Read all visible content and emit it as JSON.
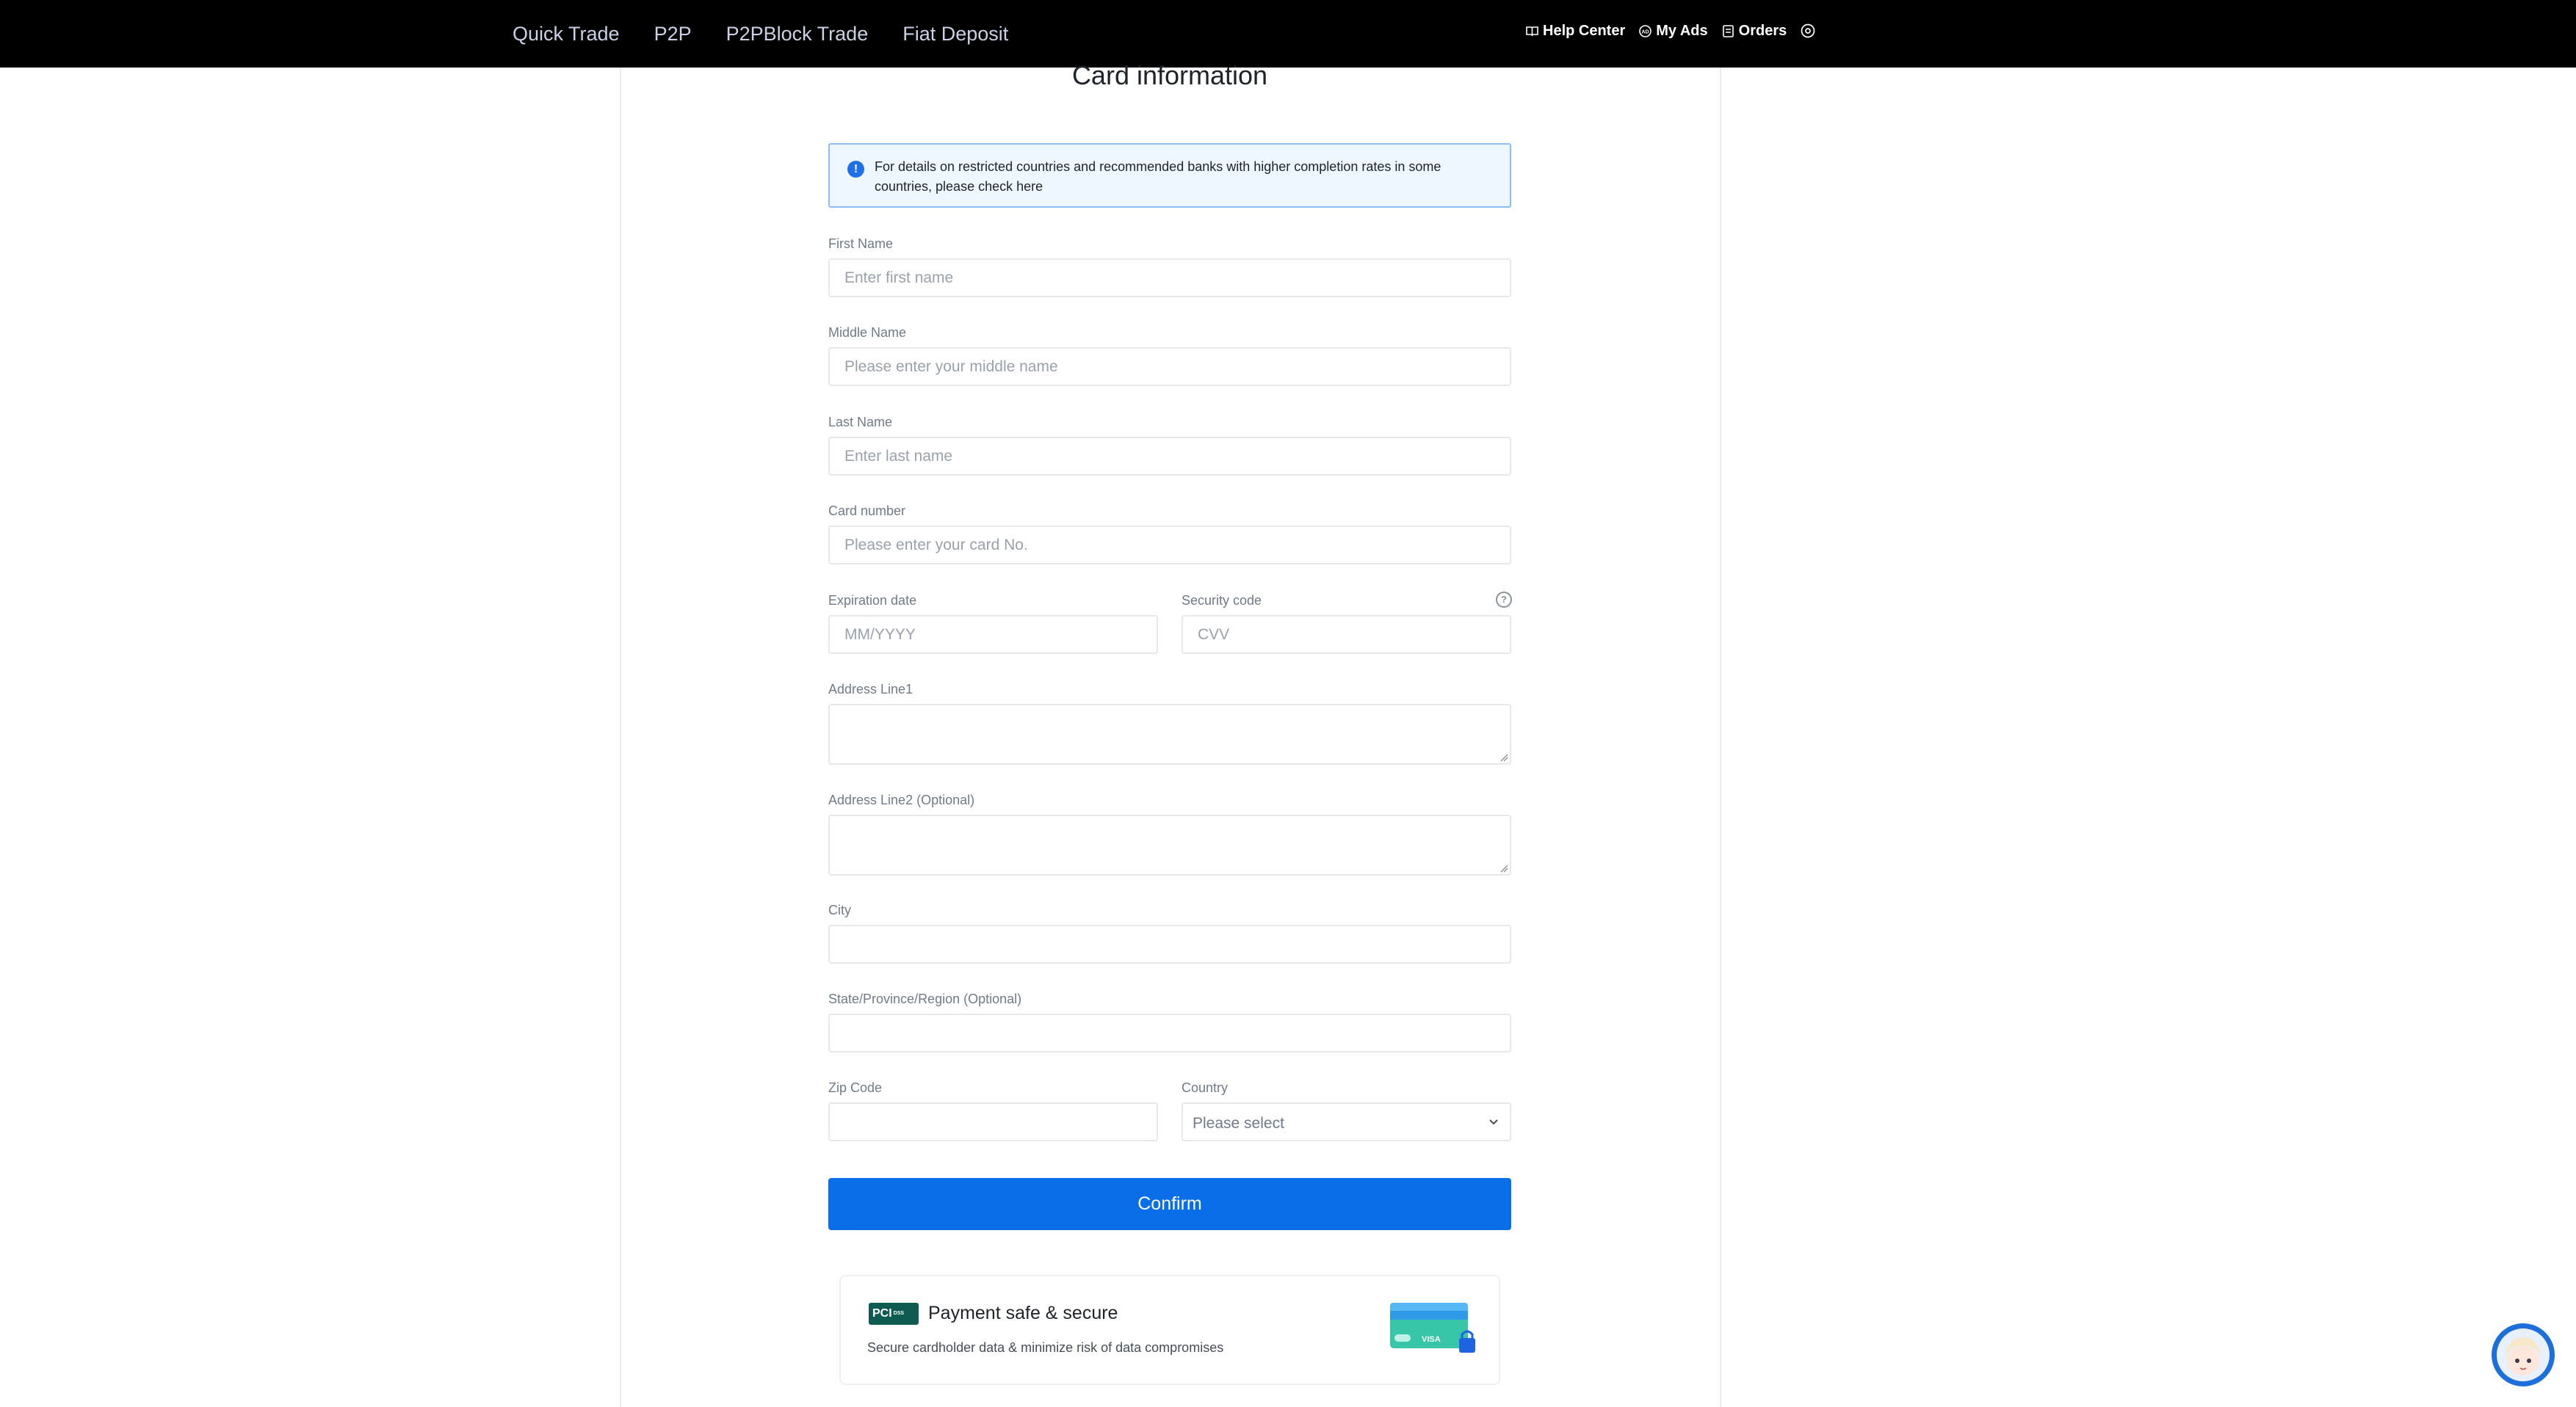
{
  "nav": {
    "items": [
      "Quick Trade",
      "P2P",
      "P2PBlock Trade",
      "Fiat Deposit"
    ],
    "help_center": "Help Center",
    "my_ads": "My Ads",
    "orders": "Orders"
  },
  "page": {
    "title": "Card information"
  },
  "notice": {
    "text": "For details on restricted countries and recommended banks with higher completion rates in some countries, please check here"
  },
  "form": {
    "first_name": {
      "label": "First Name",
      "placeholder": "Enter first name",
      "value": ""
    },
    "middle_name": {
      "label": "Middle Name",
      "placeholder": "Please enter your middle name",
      "value": ""
    },
    "last_name": {
      "label": "Last Name",
      "placeholder": "Enter last name",
      "value": ""
    },
    "card_number": {
      "label": "Card number",
      "placeholder": "Please enter your card No.",
      "value": ""
    },
    "expiration": {
      "label": "Expiration date",
      "placeholder": "MM/YYYY",
      "value": ""
    },
    "security_code": {
      "label": "Security code",
      "placeholder": "CVV",
      "value": ""
    },
    "address1": {
      "label": "Address Line1",
      "value": ""
    },
    "address2": {
      "label": "Address Line2 (Optional)",
      "value": ""
    },
    "city": {
      "label": "City",
      "value": ""
    },
    "state": {
      "label": "State/Province/Region (Optional)",
      "value": ""
    },
    "zip": {
      "label": "Zip Code",
      "value": ""
    },
    "country": {
      "label": "Country",
      "selected": "Please select"
    },
    "confirm_label": "Confirm"
  },
  "secure": {
    "badge": "PCI",
    "badge_sub": "DSS",
    "title": "Payment safe & secure",
    "subtitle": "Secure cardholder data & minimize risk of data compromises",
    "card_brand": "VISA"
  },
  "colors": {
    "primary": "#0a6ee8",
    "topbar": "#000000",
    "notice_bg": "#eef6ff",
    "pci": "#0e5b52"
  },
  "icons": [
    "book-icon",
    "ads-icon",
    "orders-icon",
    "settings-icon",
    "info-icon",
    "help-icon",
    "chevron-down-icon"
  ]
}
